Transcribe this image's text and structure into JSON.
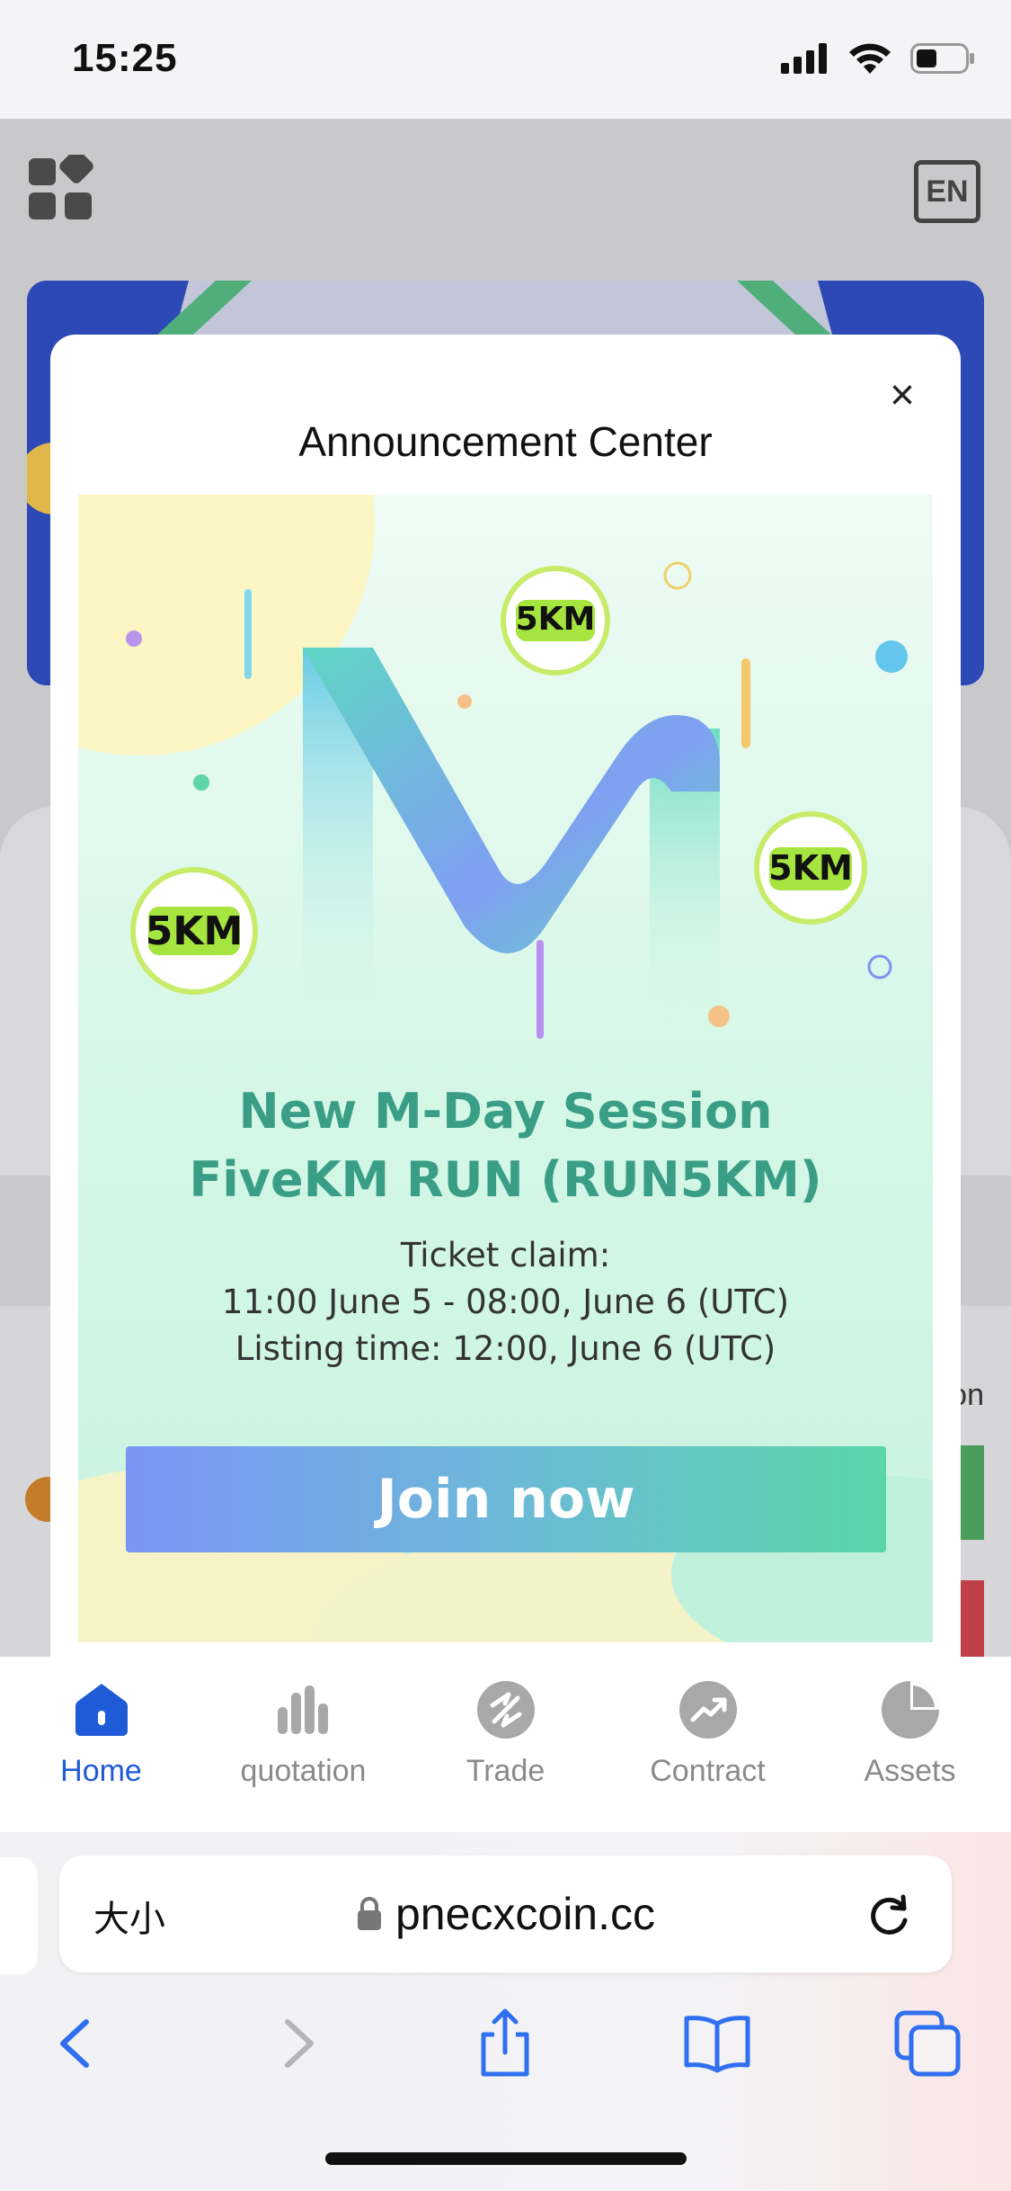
{
  "status_bar": {
    "time": "15:25"
  },
  "app": {
    "language_label": "EN",
    "partial_side_text": "on"
  },
  "modal": {
    "title": "Announcement Center",
    "close_label": "×",
    "poster": {
      "badge_text": "5KM",
      "heading_line1": "New M-Day Session",
      "heading_line2": "FiveKM RUN (RUN5KM)",
      "detail_line1": "Ticket claim:",
      "detail_line2": "11:00 June 5 - 08:00, June 6 (UTC)",
      "detail_line3": "Listing time: 12:00, June 6  (UTC)",
      "cta_label": "Join now"
    }
  },
  "tabbar": {
    "active_color": "#1f5bd6",
    "items": [
      {
        "label": "Home",
        "icon": "home-icon",
        "active": true
      },
      {
        "label": "quotation",
        "icon": "bar-chart-icon",
        "active": false
      },
      {
        "label": "Trade",
        "icon": "trade-icon",
        "active": false
      },
      {
        "label": "Contract",
        "icon": "trend-up-icon",
        "active": false
      },
      {
        "label": "Assets",
        "icon": "pie-chart-icon",
        "active": false
      }
    ]
  },
  "browser": {
    "text_size_label": "大小",
    "url": "pnecxcoin.cc"
  }
}
